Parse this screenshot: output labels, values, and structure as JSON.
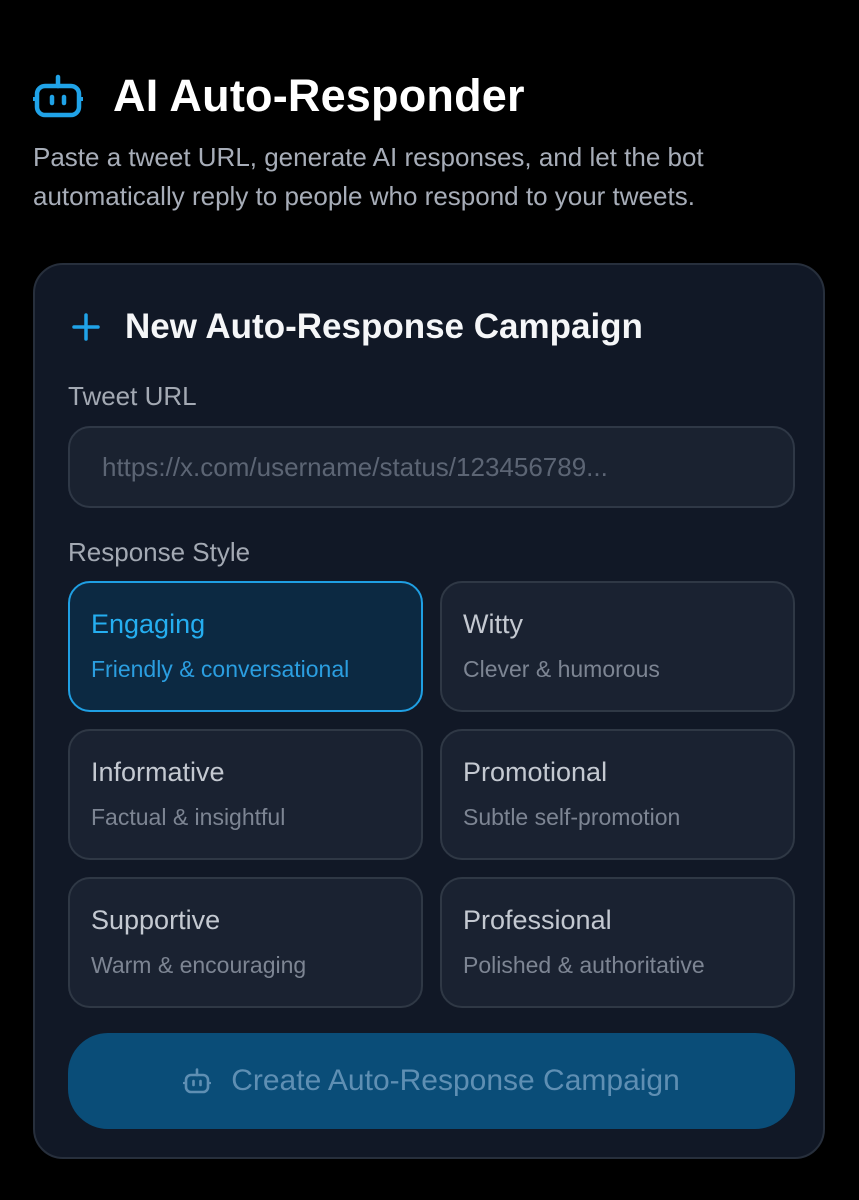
{
  "header": {
    "title": "AI Auto-Responder",
    "subtitle": "Paste a tweet URL, generate AI responses, and let the bot automatically reply to people who respond to your tweets.",
    "icon": "bot-icon"
  },
  "campaign_form": {
    "title": "New Auto-Response Campaign",
    "title_icon": "plus-icon",
    "tweet_url": {
      "label": "Tweet URL",
      "value": "",
      "placeholder": "https://x.com/username/status/123456789..."
    },
    "response_style": {
      "label": "Response Style",
      "selected": "Engaging",
      "options": [
        {
          "name": "Engaging",
          "description": "Friendly & conversational"
        },
        {
          "name": "Witty",
          "description": "Clever & humorous"
        },
        {
          "name": "Informative",
          "description": "Factual & insightful"
        },
        {
          "name": "Promotional",
          "description": "Subtle self-promotion"
        },
        {
          "name": "Supportive",
          "description": "Warm & encouraging"
        },
        {
          "name": "Professional",
          "description": "Polished & authoritative"
        }
      ]
    },
    "submit": {
      "label": "Create Auto-Response Campaign",
      "icon": "bot-icon"
    }
  },
  "colors": {
    "accent": "#1f9fe3",
    "background": "#000000",
    "card": "#111826",
    "button": "#0a4d78"
  }
}
